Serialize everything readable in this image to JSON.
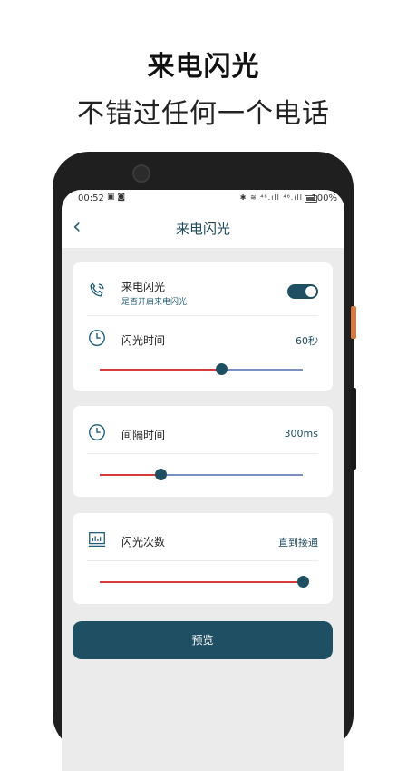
{
  "promo": {
    "title": "来电闪光",
    "subtitle": "不错过任何一个电话"
  },
  "status_bar": {
    "time": "00:52",
    "battery_percent": "100%",
    "signal_icons": "✱ ≋ ⁴⁶.ıll ⁴⁶.ıll"
  },
  "app_bar": {
    "title": "来电闪光",
    "back_icon": "chevron-left-icon"
  },
  "flash_card": {
    "incoming": {
      "label": "来电闪光",
      "sublabel": "是否开启来电闪光",
      "icon": "phone-icon",
      "enabled": true
    },
    "flash_time": {
      "label": "闪光时间",
      "value": "60秒",
      "icon": "clock-icon",
      "slider_fraction": 0.6
    }
  },
  "interval_card": {
    "label": "间隔时间",
    "value": "300ms",
    "icon": "clock-icon",
    "slider_fraction": 0.3
  },
  "count_card": {
    "label": "闪光次数",
    "value": "直到接通",
    "icon": "chart-icon",
    "slider_fraction": 1.0
  },
  "preview_button": {
    "label": "预览"
  },
  "colors": {
    "accent": "#1f4f63",
    "slider_active": "#d73b3b",
    "slider_inactive": "#7c8fc3"
  }
}
